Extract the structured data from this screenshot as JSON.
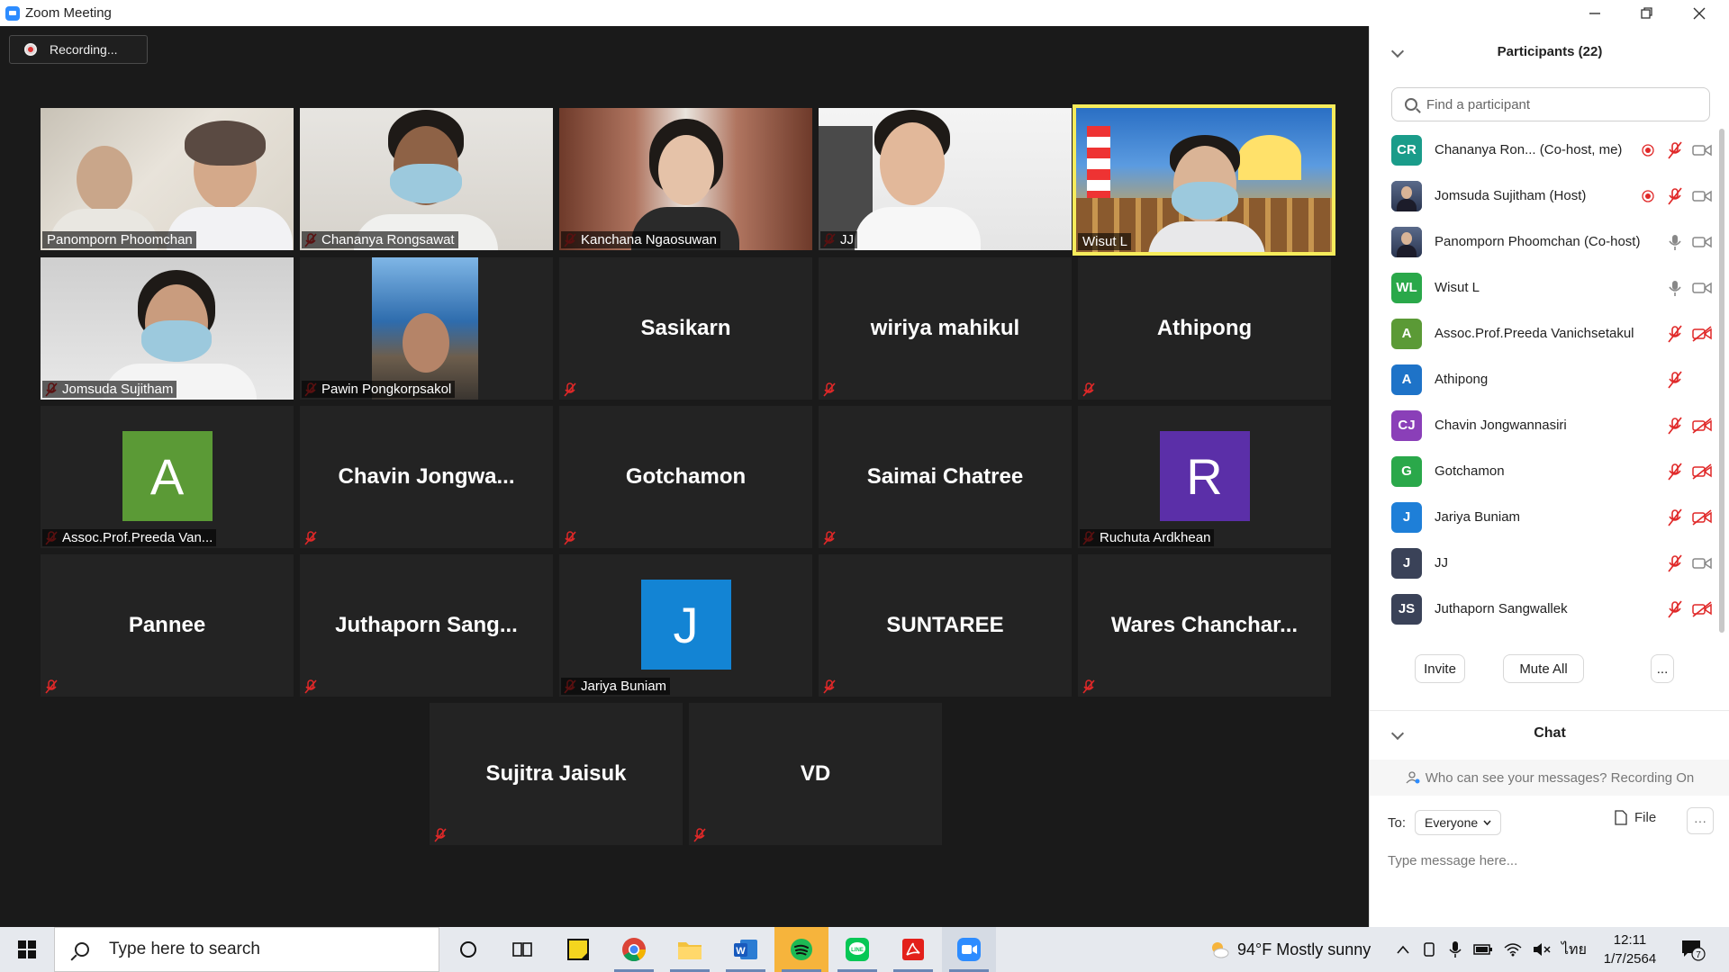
{
  "window": {
    "title": "Zoom Meeting"
  },
  "recording": {
    "label": "Recording..."
  },
  "tiles": [
    {
      "name": "Panomporn Phoomchan",
      "muted": false,
      "type": "video"
    },
    {
      "name": "Chananya Rongsawat",
      "muted": true,
      "type": "video"
    },
    {
      "name": "Kanchana Ngaosuwan",
      "muted": true,
      "type": "video"
    },
    {
      "name": "JJ",
      "muted": true,
      "type": "video"
    },
    {
      "name": "Wisut L",
      "muted": false,
      "type": "video",
      "active": true
    },
    {
      "name": "Jomsuda Sujitham",
      "muted": true,
      "type": "video"
    },
    {
      "name": "Pawin Pongkorpsakol",
      "muted": true,
      "type": "photo"
    },
    {
      "center": "Sasikarn",
      "muted": true,
      "type": "name"
    },
    {
      "center": "wiriya mahikul",
      "muted": true,
      "type": "name"
    },
    {
      "center": "Athipong",
      "muted": true,
      "type": "name"
    },
    {
      "name": "Assoc.Prof.Preeda Van...",
      "muted": true,
      "type": "avatar",
      "letter": "A",
      "color": "#5b9a36"
    },
    {
      "center": "Chavin  Jongwa...",
      "muted": true,
      "type": "name"
    },
    {
      "center": "Gotchamon",
      "muted": true,
      "type": "name"
    },
    {
      "center": "Saimai Chatree",
      "muted": true,
      "type": "name"
    },
    {
      "name": "Ruchuta Ardkhean",
      "muted": true,
      "type": "avatar",
      "letter": "R",
      "color": "#5b2fa8"
    },
    {
      "center": "Pannee",
      "muted": true,
      "type": "name"
    },
    {
      "center": "Juthaporn  Sang...",
      "muted": true,
      "type": "name"
    },
    {
      "name": "Jariya Buniam",
      "muted": true,
      "type": "avatar",
      "letter": "J",
      "color": "#1384d4"
    },
    {
      "center": "SUNTAREE",
      "muted": true,
      "type": "name"
    },
    {
      "center": "Wares  Chanchar...",
      "muted": true,
      "type": "name"
    },
    {
      "center": "Sujitra Jaisuk",
      "muted": true,
      "type": "name"
    },
    {
      "center": "VD",
      "muted": true,
      "type": "name"
    }
  ],
  "participants_panel": {
    "title": "Participants (22)",
    "search_placeholder": "Find a participant",
    "participants": [
      {
        "initials": "CR",
        "color": "#1a9c8a",
        "name": "Chananya Ron...  (Co-host, me)",
        "rec": true,
        "mic": "muted",
        "video": "on"
      },
      {
        "initials": "",
        "color": "#3b4a6b",
        "name": "Jomsuda Sujitham (Host)",
        "rec": true,
        "mic": "muted",
        "video": "on",
        "photo": true
      },
      {
        "initials": "",
        "color": "#3b4a6b",
        "name": "Panomporn Phoomchan (Co-host)",
        "rec": false,
        "mic": "on",
        "video": "on",
        "photo": true
      },
      {
        "initials": "WL",
        "color": "#2aa84a",
        "name": "Wisut L",
        "rec": false,
        "mic": "on",
        "video": "on"
      },
      {
        "initials": "A",
        "color": "#5b9a36",
        "name": "Assoc.Prof.Preeda Vanichsetakul",
        "rec": false,
        "mic": "muted",
        "video": "off"
      },
      {
        "initials": "A",
        "color": "#1e73c8",
        "name": "Athipong",
        "rec": false,
        "mic": "muted",
        "video": "none"
      },
      {
        "initials": "CJ",
        "color": "#8a3fb8",
        "name": "Chavin Jongwannasiri",
        "rec": false,
        "mic": "muted",
        "video": "off"
      },
      {
        "initials": "G",
        "color": "#2aa84a",
        "name": "Gotchamon",
        "rec": false,
        "mic": "muted",
        "video": "off"
      },
      {
        "initials": "J",
        "color": "#1e7fd8",
        "name": "Jariya Buniam",
        "rec": false,
        "mic": "muted",
        "video": "off"
      },
      {
        "initials": "J",
        "color": "#3a4258",
        "name": "JJ",
        "rec": false,
        "mic": "muted",
        "video": "on"
      },
      {
        "initials": "JS",
        "color": "#3a4258",
        "name": "Juthaporn Sangwallek",
        "rec": false,
        "mic": "muted",
        "video": "off"
      }
    ],
    "invite_label": "Invite",
    "mute_all_label": "Mute All",
    "more_label": "..."
  },
  "chat_panel": {
    "title": "Chat",
    "info": "Who can see your messages? Recording On",
    "to_label": "To:",
    "to_value": "Everyone",
    "file_label": "File",
    "more_label": "···",
    "message_placeholder": "Type message here..."
  },
  "taskbar": {
    "search_placeholder": "Type here to search",
    "weather": "94°F  Mostly sunny",
    "language": "ไทย",
    "time": "12:11",
    "date": "1/7/2564",
    "notifications": "7"
  },
  "colors": {
    "accent": "#2D8CFF",
    "active_border": "#f7ec5b",
    "muted_red": "#e02828"
  }
}
